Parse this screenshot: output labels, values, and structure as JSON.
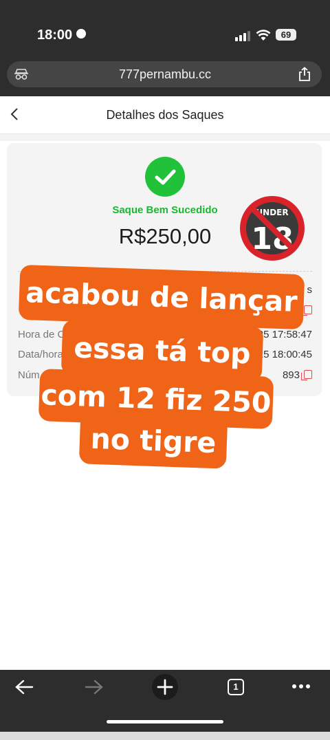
{
  "status_bar": {
    "time": "18:00",
    "battery": "69"
  },
  "browser": {
    "url": "777pernambu.cc",
    "tab_count": "1"
  },
  "header": {
    "title": "Detalhes dos Saques"
  },
  "withdrawal": {
    "status": "Saque Bem Sucedido",
    "amount": "R$250,00",
    "badge": "UNDER 18",
    "rows": [
      {
        "label": "",
        "value": "s"
      },
      {
        "label": "",
        "value": ""
      },
      {
        "label": "Hora de C",
        "value": "25 17:58:47"
      },
      {
        "label": "Data/hora",
        "value": "025 18:00:45"
      },
      {
        "label": "Núm",
        "value": "893"
      }
    ]
  },
  "overlay": {
    "lines": [
      "acabou de lançar",
      "essa tá top",
      "com 12 fiz 250",
      "no tigre"
    ],
    "color": "#f06418"
  }
}
